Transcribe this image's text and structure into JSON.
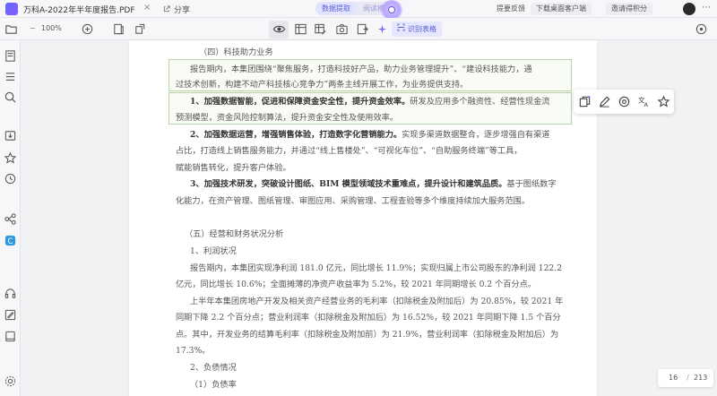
{
  "titlebar": {
    "file_title": "万科A-2022年半年度报告.PDF",
    "close_glyph": "×",
    "share_label": "分享",
    "mode_tabs": [
      {
        "label": "数据提取",
        "active": true
      },
      {
        "label": "阅读模式",
        "active": false
      }
    ],
    "feedback": "提要反馈",
    "download": "下载桌面客户端",
    "invite": "邀请得积分",
    "window_controls": "⋯"
  },
  "toolbar": {
    "zoom_level": "100%",
    "recognize_table": "识别表格"
  },
  "document": {
    "lines": [
      {
        "text": "（四）科技助力业务",
        "bold": false
      },
      {
        "text": "报告期内，本集团围绕“聚焦服务，打造科技好产品，助力业务管理提升”、“建设科技能力，通",
        "bold": false
      },
      {
        "text": "过技术创新，构建不动产科技核心竞争力”两条主线开展工作，为业务提供支持。",
        "bold": false
      },
      {
        "bold_text": "1、加强数据智能，促进和保障资金安全性，提升资金效率。",
        "text": "研发及应用多个融资性、经营性现金流"
      },
      {
        "text": "预测模型，资金风险控制算法，提升资金安全性及使用效率。",
        "bold": false
      },
      {
        "bold_text": "2、加强数据运营，增强销售体验，打造数字化营销能力。",
        "text": "实现多渠道数据整合，逐步增强自有渠道"
      },
      {
        "text": "占比，打造线上销售服务能力，并通过“线上售楼处”、“可视化车位”、“自助服务终端”等工具，",
        "bold": false
      },
      {
        "text": "赋能销售转化，提升客户体验。",
        "bold": false
      },
      {
        "bold_text": "3、加强技术研发，突破设计图纸、BIM 模型领域技术重难点，提升设计和建筑品质。",
        "text": "基于图纸数字"
      },
      {
        "text": "化能力，在资产管理、图纸管理、审图应用、采购管理、工程查验等多个维度持续加大服务范围。",
        "bold": false
      },
      {
        "text": "（五）经营和财务状况分析",
        "bold": false
      },
      {
        "text": "1、利润状况",
        "bold": false
      },
      {
        "text": "报告期内，本集团实现净利润 181.0 亿元，同比增长 11.9%；实现归属上市公司股东的净利润 122.2",
        "bold": false
      },
      {
        "text": "亿元，同比增长 10.6%；全面摊薄的净资产收益率为 5.2%，较 2021 年同期增长 0.2 个百分点。",
        "bold": false
      },
      {
        "text": "上半年本集团房地产开发及相关资产经营业务的毛利率（扣除税金及附加后）为 20.85%，较 2021 年",
        "bold": false
      },
      {
        "text": "同期下降 2.2 个百分点；营业利润率（扣除税金及附加后）为 16.52%，较 2021 年同期下降 1.5 个百分",
        "bold": false
      },
      {
        "text": "点。其中，开发业务的结算毛利率（扣除税金及附加前）为 21.9%，营业利润率（扣除税金及附加后）为",
        "bold": false
      },
      {
        "text": "17.3%。",
        "bold": false
      },
      {
        "text": "2、负债情况",
        "bold": false
      },
      {
        "text": "（1）负债率",
        "bold": false
      }
    ]
  },
  "page_indicator": {
    "current": "16",
    "separator": "/",
    "total": "213"
  }
}
